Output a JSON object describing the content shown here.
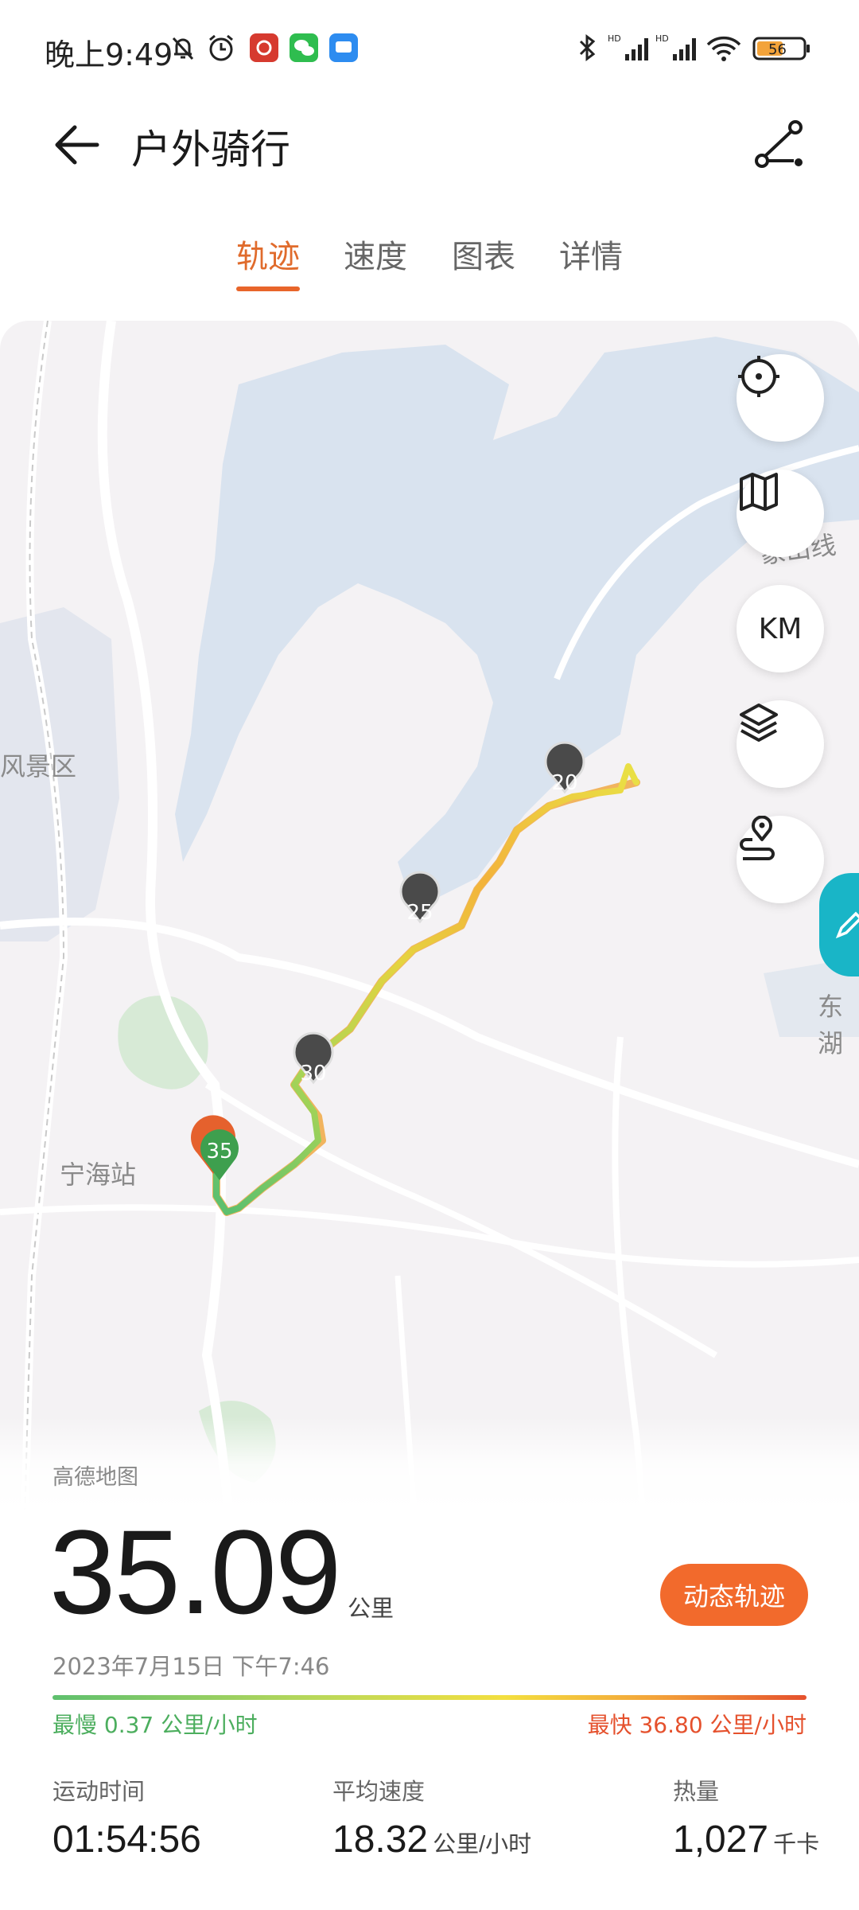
{
  "status_bar": {
    "time": "晚上9:49",
    "battery": "56"
  },
  "header": {
    "title": "户外骑行"
  },
  "tabs": [
    {
      "label": "轨迹",
      "active": true
    },
    {
      "label": "速度",
      "active": false
    },
    {
      "label": "图表",
      "active": false
    },
    {
      "label": "详情",
      "active": false
    }
  ],
  "map": {
    "labels": {
      "scenic_area": "风景区",
      "station": "宁海站",
      "road": "象山线",
      "east": "东湖"
    },
    "km_button": "KM",
    "markers": [
      "20",
      "25",
      "30",
      "35"
    ],
    "route_colors": {
      "slow": "#5ec06e",
      "medium": "#f3df3f",
      "fast": "#e5512d"
    }
  },
  "summary": {
    "provider": "高德地图",
    "distance": "35.09",
    "distance_unit": "公里",
    "datetime": "2023年7月15日 下午7:46",
    "dynamic_button": "动态轨迹",
    "slowest": "最慢 0.37 公里/小时",
    "fastest": "最快 36.80 公里/小时",
    "stats": [
      {
        "label": "运动时间",
        "value": "01:54:56",
        "unit": ""
      },
      {
        "label": "平均速度",
        "value": "18.32",
        "unit": "公里/小时"
      },
      {
        "label": "热量",
        "value": "1,027",
        "unit": "千卡"
      }
    ]
  }
}
